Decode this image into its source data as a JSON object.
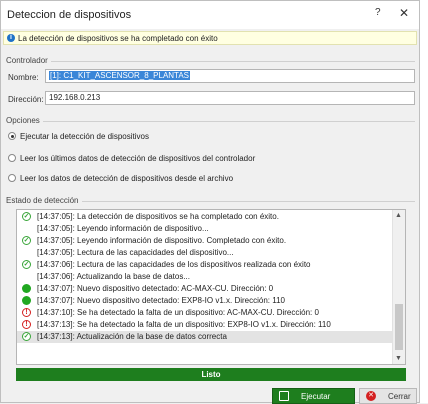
{
  "window": {
    "title": "Deteccion de dispositivos",
    "help_label": "?",
    "close_label": "✕"
  },
  "info": {
    "icon": "info-icon",
    "icon_glyph": "i",
    "message": "La detección de dispositivos se ha completado con éxito"
  },
  "controller": {
    "group_label": "Controlador",
    "name_label": "Nombre:",
    "name_value": "[1]: C1_KIT_ASCENSOR_8_PLANTAS",
    "address_label": "Dirección:",
    "address_value": "192.168.0.213"
  },
  "options": {
    "group_label": "Opciones",
    "items": [
      {
        "label": "Ejecutar la detección de dispositivos",
        "checked": true
      },
      {
        "label": "Leer los últimos datos de detección de dispositivos del controlador",
        "checked": false
      },
      {
        "label": "Leer los datos de detección de dispositivos desde el archivo",
        "checked": false
      }
    ]
  },
  "detection": {
    "group_label": "Estado de detección",
    "log": [
      {
        "status": "ok",
        "text": "[14:37:05]: La detección de dispositivos se ha completado con éxito."
      },
      {
        "status": "none",
        "text": "[14:37:05]: Leyendo información de dispositivo..."
      },
      {
        "status": "ok",
        "text": "[14:37:05]: Leyendo información de dispositivo. Completado con éxito."
      },
      {
        "status": "none",
        "text": "[14:37:05]: Lectura de las capacidades del dispositivo..."
      },
      {
        "status": "ok",
        "text": "[14:37:06]: Lectura de las capacidades de los dispositivos realizada con éxito"
      },
      {
        "status": "none",
        "text": "[14:37:06]: Actualizando la base de datos..."
      },
      {
        "status": "dot",
        "text": "[14:37:07]: Nuevo dispositivo detectado: AC-MAX-CU. Dirección: 0"
      },
      {
        "status": "dot",
        "text": "[14:37:07]: Nuevo dispositivo detectado: EXP8-IO v1.x. Dirección: 110"
      },
      {
        "status": "error",
        "text": "[14:37:10]: Se ha detectado la falta de un dispositivo: AC-MAX-CU. Dirección: 0"
      },
      {
        "status": "error",
        "text": "[14:37:13]: Se ha detectado la falta de un dispositivo: EXP8-IO v1.x. Dirección: 110"
      },
      {
        "status": "ok",
        "text": "[14:37:13]: Actualización de la base de datos correcta"
      }
    ]
  },
  "status_text": "Listo",
  "buttons": {
    "execute_label": "Ejecutar",
    "close_label": "Cerrar"
  },
  "colors": {
    "accent_green": "#1e7e1e",
    "selection_blue": "#3a86d8",
    "error_red": "#d42020",
    "info_bg": "#ffffe1"
  }
}
